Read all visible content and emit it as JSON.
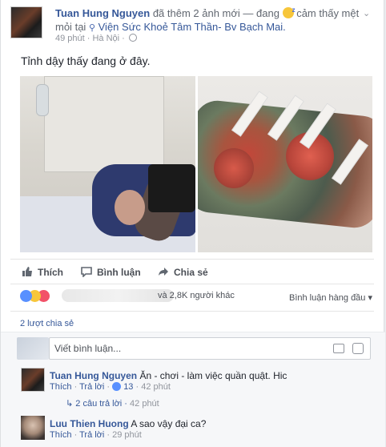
{
  "post": {
    "author": "Tuan Hung Nguyen",
    "action": "đã thêm 2 ảnh mới — đang",
    "feeling": "cảm thấy mệt mỏi",
    "at": "tại",
    "location": "Viện Sức Khoẻ Tâm Thần- Bv Bạch Mai.",
    "time": "49 phút",
    "place": "Hà Nội",
    "text": "Tỉnh dậy thấy đang ở đây."
  },
  "actions": {
    "like": "Thích",
    "comment": "Bình luận",
    "share": "Chia sẻ"
  },
  "reactions": {
    "others": "và 2,8K người khác",
    "top_comments": "Bình luận hàng đầu"
  },
  "shares": "2 lượt chia sẻ",
  "composer": {
    "placeholder": "Viết bình luận..."
  },
  "comments": [
    {
      "author": "Tuan Hung Nguyen",
      "text": "Ăn - chơi - làm việc quần quật. Hic",
      "like": "Thích",
      "reply": "Trả lời",
      "likes": "13",
      "time": "42 phút",
      "replies": "2 câu trả lời",
      "replies_time": "42 phút"
    },
    {
      "author": "Luu Thien Huong",
      "text": "A sao vậy đại ca?",
      "like": "Thích",
      "reply": "Trả lời",
      "time": "29 phút"
    }
  ],
  "icons": [
    "chevron-down-icon",
    "pin-icon",
    "globe-icon",
    "like-icon",
    "comment-icon",
    "share-icon",
    "camera-icon",
    "sticker-icon"
  ],
  "colors": {
    "link": "#365899",
    "like_blue": "#5890ff",
    "love_red": "#f25268"
  }
}
